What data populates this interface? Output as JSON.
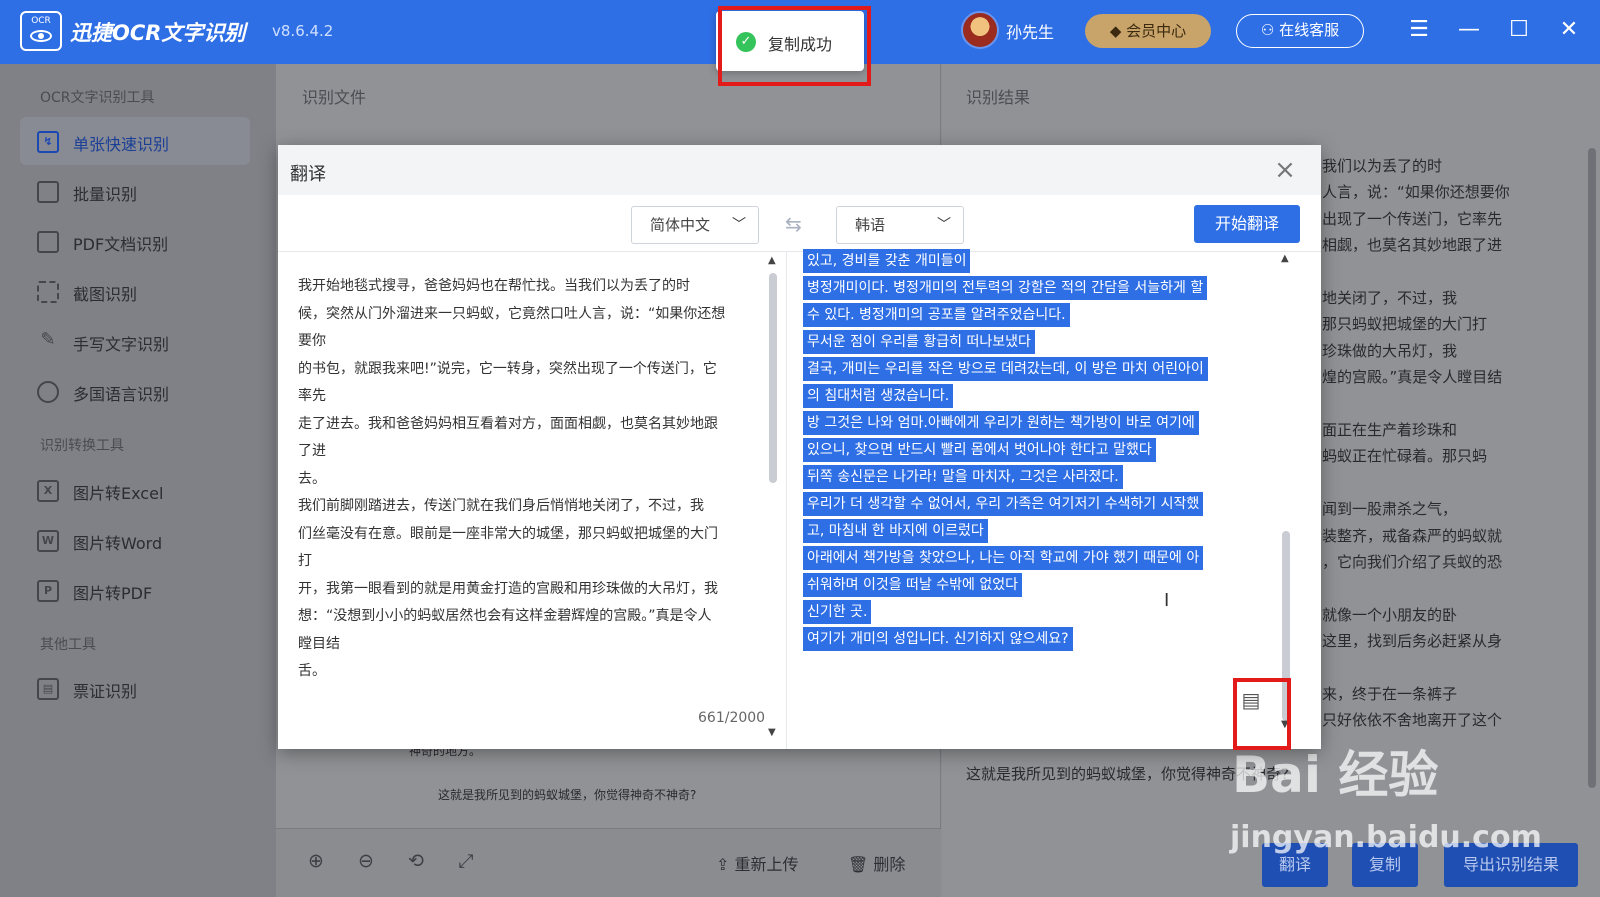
{
  "app": {
    "title": "迅捷OCR文字识别",
    "version": "v8.6.4.2",
    "logo_text": "OCR"
  },
  "toast": {
    "text": "复制成功"
  },
  "header": {
    "username": "孙先生",
    "vip_label": "会员中心",
    "service_label": "在线客服"
  },
  "window_controls": {
    "menu": "☰",
    "minimize": "—",
    "maximize": "☐",
    "close": "✕"
  },
  "sidebar": {
    "sections": [
      {
        "title": "OCR文字识别工具",
        "items": [
          {
            "label": "单张快速识别",
            "icon": "single-scan-icon",
            "glyph": "↯",
            "active": true
          },
          {
            "label": "批量识别",
            "icon": "batch-icon",
            "glyph": ""
          },
          {
            "label": "PDF文档识别",
            "icon": "pdf-doc-icon",
            "glyph": ""
          },
          {
            "label": "截图识别",
            "icon": "crop-icon",
            "glyph": ""
          },
          {
            "label": "手写文字识别",
            "icon": "handwriting-icon",
            "glyph": ""
          },
          {
            "label": "多国语言识别",
            "icon": "globe-icon",
            "glyph": ""
          }
        ]
      },
      {
        "title": "识别转换工具",
        "items": [
          {
            "label": "图片转Excel",
            "icon": "excel-icon",
            "glyph": "X"
          },
          {
            "label": "图片转Word",
            "icon": "word-icon",
            "glyph": "W"
          },
          {
            "label": "图片转PDF",
            "icon": "pdf-icon",
            "glyph": "P"
          }
        ]
      },
      {
        "title": "其他工具",
        "items": [
          {
            "label": "票证识别",
            "icon": "ticket-icon",
            "glyph": "▤"
          }
        ]
      }
    ]
  },
  "center": {
    "header": "识别文件",
    "doc_lines": [
      "神奇的地方。",
      "这就是我所见到的蚂蚁城堡，你觉得神奇不神奇?"
    ],
    "bottom": {
      "reupload": "重新上传",
      "delete": "删除"
    }
  },
  "right": {
    "header": "识别结果",
    "visible_lines": [
      "我们以为丢了的时",
      "人言，说：“如果你还想要你",
      "出现了一个传送门，它率先",
      "相觑，也莫名其妙地跟了进",
      "",
      "地关闭了，不过，我",
      "那只蚂蚁把城堡的大门打",
      "珍珠做的大吊灯，我",
      "煌的宫殿。”真是令人瞠目结",
      "",
      "面正在生产着珍珠和",
      "蚂蚁正在忙碌着。那只蚂",
      "",
      "闻到一股肃杀之气，",
      "装整齐，戒备森严的蚂蚁就",
      "，它向我们介绍了兵蚁的恐",
      "",
      "就像一个小朋友的卧",
      "这里，找到后务必赶紧从身",
      "",
      "来，终于在一条裤子",
      "只好依依不舍地离开了这个"
    ],
    "last_line": "这就是我所见到的蚂蚁城堡，你觉得神奇不神奇?",
    "buttons": {
      "translate": "翻译",
      "copy": "复制",
      "export": "导出识别结果"
    }
  },
  "watermark": {
    "brand": "Bai  经验",
    "url": "jingyan.baidu.com"
  },
  "modal": {
    "title": "翻译",
    "source_lang": "简体中文",
    "target_lang": "韩语",
    "start_label": "开始翻译",
    "source_lines": [
      "我开始地毯式搜寻，爸爸妈妈也在帮忙找。当我们以为丢了的时",
      "候，突然从门外溜进来一只蚂蚁，它竟然口吐人言，说：“如果你还想",
      "要你",
      "的书包，就跟我来吧!”说完，它一转身，突然出现了一个传送门，它",
      "率先",
      "走了进去。我和爸爸妈妈相互看着对方，面面相觑，也莫名其妙地跟",
      "了进",
      "去。",
      "我们前脚刚踏进去，传送门就在我们身后悄悄地关闭了，不过，我",
      "们丝毫没有在意。眼前是一座非常大的城堡，那只蚂蚁把城堡的大门",
      "打",
      "开，我第一眼看到的就是用黄金打造的宫殿和用珍珠做的大吊灯，我",
      "想：“没想到小小的蚂蚁居然也会有这样金碧辉煌的宫殿。”真是令人",
      "瞠目结",
      "舌。"
    ],
    "char_count": "661/2000",
    "translated_lines": [
      "있고, 경비를 갖춘 개미들이",
      "병정개미이다. 병정개미의 전투력의 강함은 적의 간담을 서늘하게 할",
      "수 있다. 병정개미의 공포를 알려주었습니다.",
      "무서운 점이 우리를 황급히 떠나보냈다",
      "결국, 개미는 우리를 작은 방으로 데려갔는데, 이 방은 마치 어린아이",
      "의 침대처럼 생겼습니다.",
      "방 그것은 나와 엄마.아빠에게 우리가 원하는 책가방이 바로 여기에",
      "있으니, 찾으면 반드시 빨리 몸에서 벗어나야 한다고 말했다",
      "뒤쪽 송신문은 나가라! 말을 마치자, 그것은 사라졌다.",
      "우리가 더 생각할 수 없어서, 우리 가족은 여기저기 수색하기 시작했",
      "고, 마침내 한 바지에 이르렀다",
      "아래에서 책가방을 찾았으나, 나는 아직 학교에 가야 했기 때문에 아",
      "쉬워하며 이것을 떠날 수밖에 없었다",
      "신기한 곳.",
      "여기가 개미의 성입니다. 신기하지 않으세요?"
    ]
  }
}
